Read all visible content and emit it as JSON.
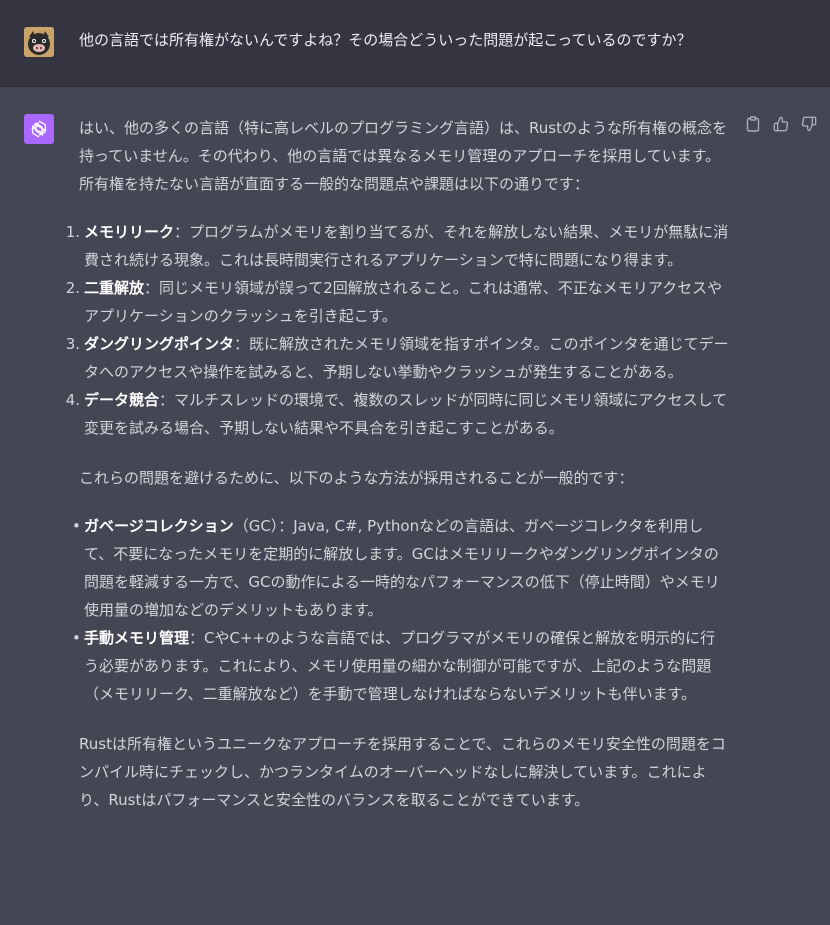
{
  "user": {
    "message": "他の言語では所有権がないんですよね？その場合どういった問題が起こっているのですか？"
  },
  "assistant": {
    "intro": "はい、他の多くの言語（特に高レベルのプログラミング言語）は、Rustのような所有権の概念を持っていません。その代わり、他の言語では異なるメモリ管理のアプローチを採用しています。所有権を持たない言語が直面する一般的な問題点や課題は以下の通りです：",
    "problems": [
      {
        "num": "1.",
        "term": "メモリリーク",
        "desc": "：プログラムがメモリを割り当てるが、それを解放しない結果、メモリが無駄に消費され続ける現象。これは長時間実行されるアプリケーションで特に問題になり得ます。"
      },
      {
        "num": "2.",
        "term": "二重解放",
        "desc": "：同じメモリ領域が誤って2回解放されること。これは通常、不正なメモリアクセスやアプリケーションのクラッシュを引き起こす。"
      },
      {
        "num": "3.",
        "term": "ダングリングポインタ",
        "desc": "：既に解放されたメモリ領域を指すポインタ。このポインタを通じてデータへのアクセスや操作を試みると、予期しない挙動やクラッシュが発生することがある。"
      },
      {
        "num": "4.",
        "term": "データ競合",
        "desc": "：マルチスレッドの環境で、複数のスレッドが同時に同じメモリ領域にアクセスして変更を試みる場合、予期しない結果や不具合を引き起こすことがある。"
      }
    ],
    "middle": "これらの問題を避けるために、以下のような方法が採用されることが一般的です：",
    "methods": [
      {
        "term": "ガベージコレクション",
        "desc": "（GC）：Java, C#, Pythonなどの言語は、ガベージコレクタを利用して、不要になったメモリを定期的に解放します。GCはメモリリークやダングリングポインタの問題を軽減する一方で、GCの動作による一時的なパフォーマンスの低下（停止時間）やメモリ使用量の増加などのデメリットもあります。"
      },
      {
        "term": "手動メモリ管理",
        "desc": "：CやC++のような言語では、プログラマがメモリの確保と解放を明示的に行う必要があります。これにより、メモリ使用量の細かな制御が可能ですが、上記のような問題（メモリリーク、二重解放など）を手動で管理しなければならないデメリットも伴います。"
      }
    ],
    "conclusion": "Rustは所有権というユニークなアプローチを採用することで、これらのメモリ安全性の問題をコンパイル時にチェックし、かつランタイムのオーバーヘッドなしに解決しています。これにより、Rustはパフォーマンスと安全性のバランスを取ることができています。"
  },
  "icons": {
    "copy": "clipboard-icon",
    "like": "thumbs-up-icon",
    "dislike": "thumbs-down-icon",
    "bot": "openai-logo-icon"
  },
  "colors": {
    "user_bg": "#343541",
    "assistant_bg": "#444654",
    "bot_avatar": "#ab68ff",
    "text": "#d1d5db"
  }
}
